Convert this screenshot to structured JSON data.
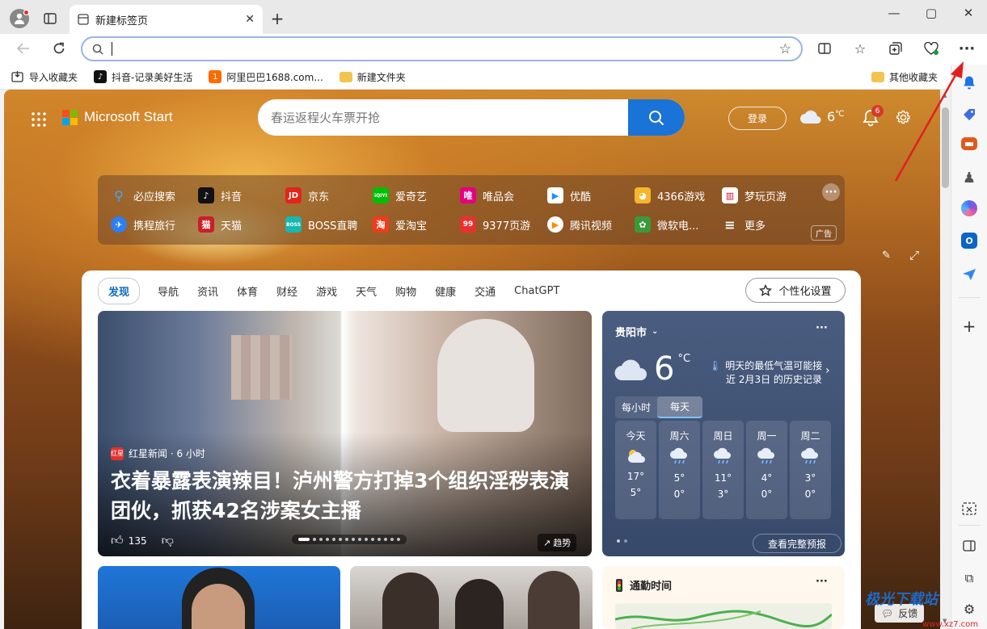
{
  "tab": {
    "title": "新建标签页"
  },
  "toolbar": {
    "address_value": ""
  },
  "favorites": {
    "items": [
      "导入收藏夹",
      "抖音-记录美好生活",
      "阿里巴巴1688.com...",
      "新建文件夹"
    ],
    "other": "其他收藏夹"
  },
  "header": {
    "brand": "Microsoft Start",
    "search_placeholder": "春运返程火车票开抢",
    "login": "登录",
    "temp": "6",
    "temp_unit": "℃",
    "notif_count": "6"
  },
  "quicklinks": {
    "row1": [
      "必应搜索",
      "抖音",
      "京东",
      "爱奇艺",
      "唯品会",
      "优酷",
      "4366游戏",
      "梦玩页游"
    ],
    "row2": [
      "携程旅行",
      "天猫",
      "BOSS直聘",
      "爱淘宝",
      "9377页游",
      "腾讯视频",
      "微软电...",
      "更多"
    ],
    "ad": "广告",
    "icon_text": {
      "jd": "JD",
      "iqiyi": "iQIYI",
      "vip": "唯",
      "boss": "BOSS",
      "taobao": "淘",
      "mi9377": "99",
      "tmall": "猫"
    }
  },
  "feed": {
    "tabs": [
      "发现",
      "导航",
      "资讯",
      "体育",
      "财经",
      "游戏",
      "天气",
      "购物",
      "健康",
      "交通",
      "ChatGPT"
    ],
    "personalize": "个性化设置"
  },
  "hero": {
    "source": "红星新闻 · 6 小时",
    "title": "衣着暴露表演辣目！泸州警方打掉3个组织淫秽表演团伙，抓获42名涉案女主播",
    "likes": "135",
    "trend": "趋势",
    "source_badge": "红星",
    "slide_index": 1,
    "slide_count": 15
  },
  "weather": {
    "city": "贵阳市",
    "temp": "6",
    "unit": "°C",
    "note_line1": "明天的最低气温可能接",
    "note_line2": "近 2月3日 的历史记录",
    "toggle": [
      "每小时",
      "每天"
    ],
    "days": [
      {
        "day": "今天",
        "hi": "17°",
        "lo": "5°",
        "icon": "partly-cloudy"
      },
      {
        "day": "周六",
        "hi": "5°",
        "lo": "0°",
        "icon": "rain"
      },
      {
        "day": "周日",
        "hi": "11°",
        "lo": "3°",
        "icon": "rain"
      },
      {
        "day": "周一",
        "hi": "4°",
        "lo": "0°",
        "icon": "rain"
      },
      {
        "day": "周二",
        "hi": "3°",
        "lo": "0°",
        "icon": "rain"
      }
    ],
    "full_forecast": "查看完整预报"
  },
  "commute": {
    "title": "通勤时间"
  },
  "watermark": {
    "text": "极光下载站",
    "sub": "www.xz7.com"
  },
  "feedback": "反馈",
  "colors": {
    "accent": "#0f6cbd",
    "search_button": "#1a73d6",
    "arrow": "#e02020"
  }
}
